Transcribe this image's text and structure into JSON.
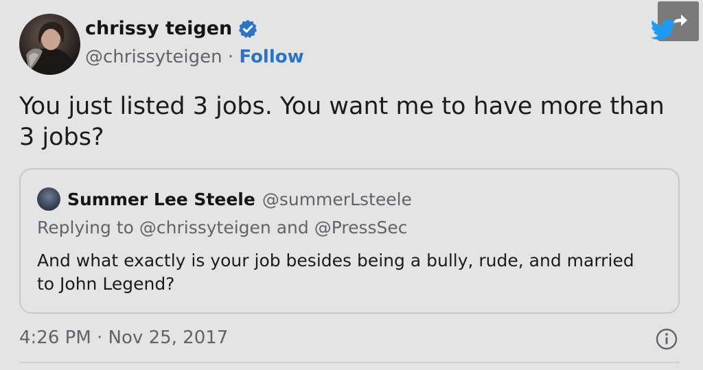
{
  "tweet": {
    "author_name": "chrissy teigen",
    "author_handle": "@chrissyteigen",
    "separator": "·",
    "follow_label": "Follow",
    "text": "You just listed 3 jobs. You want me to have more than 3 jobs?",
    "timestamp": "4:26 PM · Nov 25, 2017"
  },
  "quoted": {
    "author_name": "Summer Lee Steele",
    "author_handle": "@summerLsteele",
    "reply_context": "Replying to @chrissyteigen and @PressSec",
    "text": "And what exactly is your job besides being a bully, rude, and married to John Legend?"
  },
  "icons": {
    "verified": "verified-badge-icon",
    "share": "share-arrow-icon",
    "brand": "twitter-bird-icon",
    "info": "info-icon"
  },
  "colors": {
    "background": "#e4e4e4",
    "link": "#2b73c4",
    "verified": "#2b73c4",
    "twitter_brand": "#1d9bf0",
    "secondary_text": "#5f6469"
  }
}
